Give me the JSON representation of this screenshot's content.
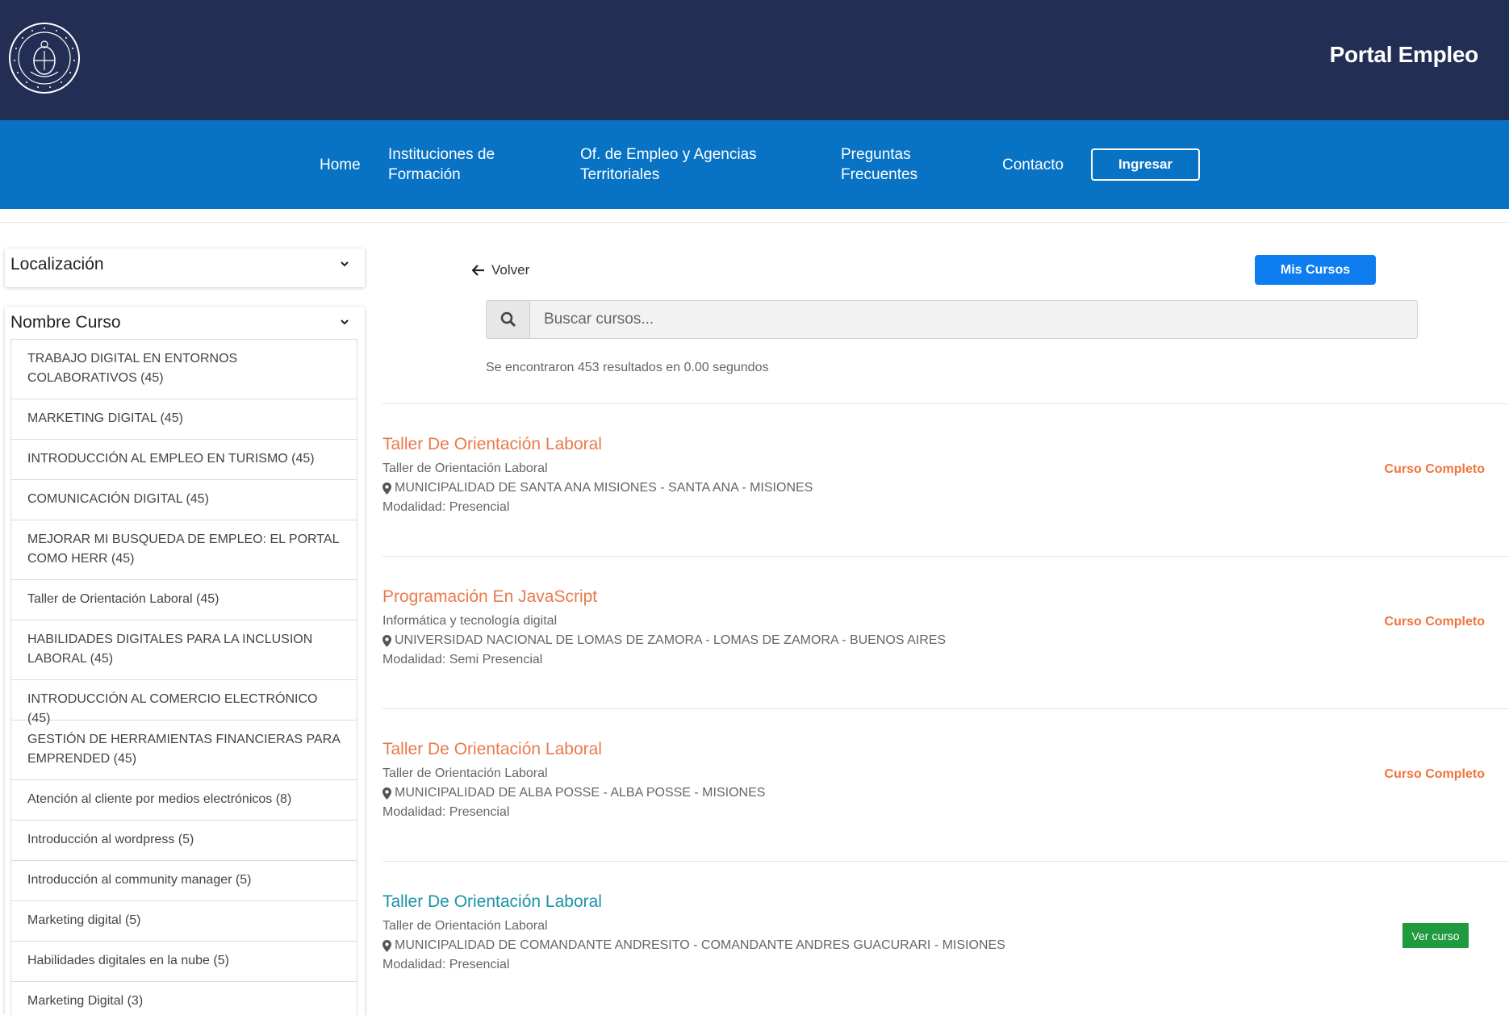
{
  "header": {
    "brand": "Portal Empleo"
  },
  "nav": {
    "home": "Home",
    "instituciones": "Instituciones de Formación",
    "oficinas": "Of. de Empleo y Agencias Territoriales",
    "preguntas": "Preguntas Frecuentes",
    "contacto": "Contacto",
    "ingresar": "Ingresar"
  },
  "sidebar": {
    "localizacion_title": "Localización",
    "nombre_curso_title": "Nombre Curso",
    "courses": [
      "TRABAJO DIGITAL EN ENTORNOS COLABORATIVOS (45)",
      "MARKETING DIGITAL (45)",
      "INTRODUCCIÓN AL EMPLEO EN TURISMO (45)",
      "COMUNICACIÓN DIGITAL (45)",
      "MEJORAR MI BUSQUEDA DE EMPLEO: EL PORTAL COMO HERR (45)",
      "Taller de Orientación Laboral (45)",
      "HABILIDADES DIGITALES PARA LA INCLUSION LABORAL (45)",
      "INTRODUCCIÓN AL COMERCIO ELECTRÓNICO (45)",
      "GESTIÓN DE HERRAMIENTAS FINANCIERAS PARA EMPRENDED (45)",
      "Atención al cliente por medios electrónicos (8)",
      "Introducción al wordpress (5)",
      "Introducción al community manager (5)",
      "Marketing digital (5)",
      "Habilidades digitales en la nube (5)",
      "Marketing Digital (3)"
    ]
  },
  "main": {
    "back": "Volver",
    "mis_cursos": "Mis Cursos",
    "search_placeholder": "Buscar cursos...",
    "results_count": "Se encontraron 453 resultados en 0.00 segundos",
    "results": [
      {
        "title": "Taller De Orientación Laboral",
        "subtitle": "Taller de Orientación Laboral",
        "location": "MUNICIPALIDAD DE SANTA ANA MISIONES - SANTA ANA - MISIONES",
        "modality": "Modalidad: Presencial",
        "status": "Curso Completo"
      },
      {
        "title": "Programación En JavaScript",
        "subtitle": "Informática y tecnología digital",
        "location": "UNIVERSIDAD NACIONAL DE LOMAS DE ZAMORA - LOMAS DE ZAMORA - BUENOS AIRES",
        "modality": "Modalidad: Semi Presencial",
        "status": "Curso Completo"
      },
      {
        "title": "Taller De Orientación Laboral",
        "subtitle": "Taller de Orientación Laboral",
        "location": "MUNICIPALIDAD DE ALBA POSSE - ALBA POSSE - MISIONES",
        "modality": "Modalidad: Presencial",
        "status": "Curso Completo"
      },
      {
        "title": "Taller De Orientación Laboral",
        "subtitle": "Taller de Orientación Laboral",
        "location": "MUNICIPALIDAD DE COMANDANTE ANDRESITO - COMANDANTE ANDRES GUACURARI - MISIONES",
        "modality": "Modalidad: Presencial",
        "action": "Ver curso"
      }
    ]
  },
  "colors": {
    "header_bg": "#232e55",
    "nav_bg": "#0873c5",
    "title_orange": "#e97a4b",
    "title_teal": "#1a93a8",
    "status_orange": "#f0733e",
    "button_blue": "#0d7df0",
    "button_green": "#1f9a3e"
  }
}
